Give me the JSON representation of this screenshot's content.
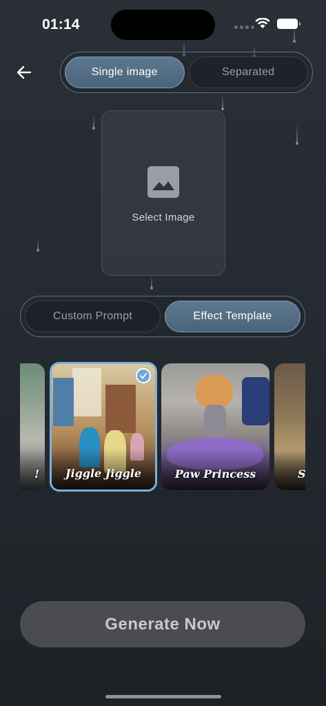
{
  "status_bar": {
    "time": "01:14"
  },
  "mode_toggle": {
    "options": [
      "Single image",
      "Separated"
    ],
    "selected": "Single image"
  },
  "upload": {
    "label": "Select Image"
  },
  "prompt_toggle": {
    "options": [
      "Custom Prompt",
      "Effect Template"
    ],
    "selected": "Effect Template"
  },
  "templates": [
    {
      "label": "!",
      "selected": false
    },
    {
      "label": "Jiggle Jiggle",
      "selected": true
    },
    {
      "label": "Paw Princess",
      "selected": false
    },
    {
      "label": "S",
      "selected": false
    }
  ],
  "generate_button": {
    "label": "Generate Now"
  },
  "colors": {
    "accent": "#7cb1e0",
    "active_pill": "#4a6479",
    "background": "#262b32",
    "button": "#4a4c51"
  }
}
